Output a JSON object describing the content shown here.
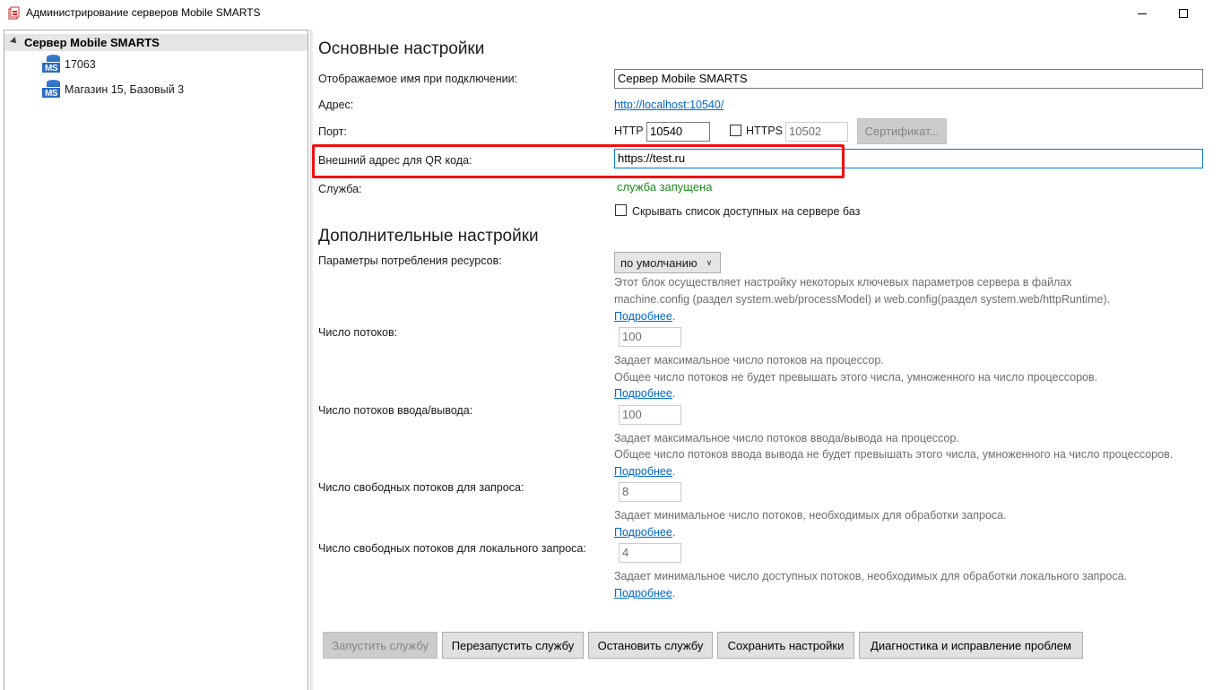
{
  "window": {
    "title": "Администрирование серверов Mobile SMARTS"
  },
  "tree": {
    "root_label": "Сервер Mobile SMARTS",
    "items": [
      {
        "label": "17063",
        "icon": "ms-database-icon"
      },
      {
        "label": "Магазин 15, Базовый 3",
        "icon": "ms-database-icon"
      }
    ]
  },
  "basic": {
    "heading": "Основные настройки",
    "display_name_label": "Отображаемое имя при подключении:",
    "display_name_value": "Сервер Mobile SMARTS",
    "address_label": "Адрес:",
    "address_link": "http://localhost:10540/",
    "port_label": "Порт:",
    "http_label": "HTTP",
    "http_value": "10540",
    "https_label": "HTTPS",
    "https_value": "10502",
    "https_checked": false,
    "cert_button": "Сертификат...",
    "qr_label": "Внешний адрес для QR кода:",
    "qr_value": "https://test.ru",
    "service_label": "Служба:",
    "service_status": "служба запущена",
    "service_status_color": "#1a8a1a",
    "hide_db_checkbox_label": "Скрывать список доступных на сервере баз",
    "hide_db_checked": false
  },
  "advanced": {
    "heading": "Дополнительные настройки",
    "resources_label": "Параметры потребления ресурсов:",
    "resources_value": "по умолчанию",
    "resources_hint_1": "Этот блок осуществляет настройку некоторых ключевых параметров сервера в файлах",
    "resources_hint_2": "machine.config (раздел system.web/processModel) и web.config(раздел system.web/httpRuntime).",
    "more_link": "Подробнее",
    "threads_label": "Число потоков:",
    "threads_value": "100",
    "threads_hint_1": "Задает максимальное число потоков на процессор.",
    "threads_hint_2": "Общее число потоков не будет превышать этого числа, умноженного на число процессоров.",
    "io_threads_label": "Число потоков ввода/вывода:",
    "io_threads_value": "100",
    "io_threads_hint_1": "Задает максимальное число потоков ввода/вывода на процессор.",
    "io_threads_hint_2": "Общее число потоков ввода вывода не будет превышать этого числа, умноженного на число процессоров.",
    "free_threads_label": "Число свободных потоков для запроса:",
    "free_threads_value": "8",
    "free_threads_hint": "Задает минимальное число потоков, необходимых для обработки запроса.",
    "free_local_label": "Число свободных потоков для локального запроса:",
    "free_local_value": "4",
    "free_local_hint": "Задает минимальное число доступных потоков, необходимых для обработки локального запроса."
  },
  "buttons": {
    "start": "Запустить службу",
    "restart": "Перезапустить службу",
    "stop": "Остановить службу",
    "save": "Сохранить настройки",
    "diagnostics": "Диагностика и исправление проблем"
  },
  "annotation": {
    "highlight_color": "#ee1111"
  }
}
